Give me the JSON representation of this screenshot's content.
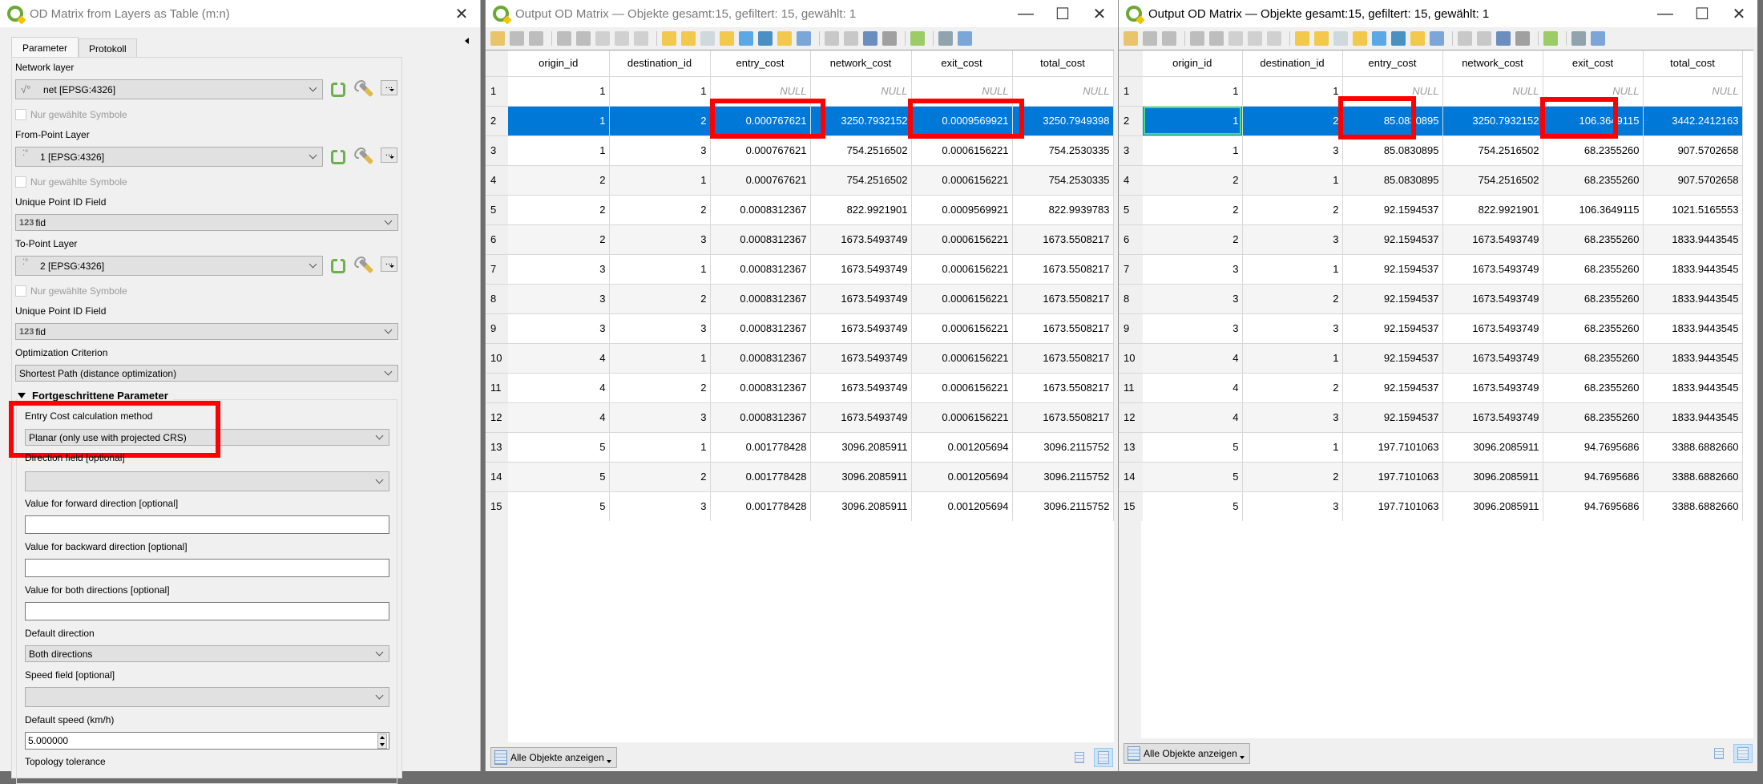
{
  "dialog": {
    "title": "OD Matrix from Layers as Table (m:n)",
    "tabs": [
      "Parameter",
      "Protokoll"
    ],
    "network_layer": {
      "label": "Network layer",
      "value": "net [EPSG:4326]"
    },
    "selected_only_label": "Nur gewählte Symbole",
    "from_point_layer": {
      "label": "From-Point Layer",
      "value": "1 [EPSG:4326]"
    },
    "from_id_field": {
      "label": "Unique Point ID Field",
      "type_badge": "123",
      "value": "fid"
    },
    "to_point_layer": {
      "label": "To-Point Layer",
      "value": "2 [EPSG:4326]"
    },
    "to_id_field": {
      "label": "Unique Point ID Field",
      "type_badge": "123",
      "value": "fid"
    },
    "optimization": {
      "label": "Optimization Criterion",
      "value": "Shortest Path (distance optimization)"
    },
    "advanced_group": "Fortgeschrittene Parameter",
    "entry_cost_method": {
      "label": "Entry Cost calculation method",
      "value": "Planar (only use with projected CRS)"
    },
    "direction_field": {
      "label": "Direction field [optional]",
      "value": ""
    },
    "forward_value": {
      "label": "Value for forward direction [optional]",
      "value": ""
    },
    "backward_value": {
      "label": "Value for backward direction [optional]",
      "value": ""
    },
    "both_value": {
      "label": "Value for both directions [optional]",
      "value": ""
    },
    "default_direction": {
      "label": "Default direction",
      "value": "Both directions"
    },
    "speed_field": {
      "label": "Speed field [optional]",
      "value": ""
    },
    "default_speed": {
      "label": "Default speed (km/h)",
      "value": "5.000000"
    },
    "topology_tolerance": {
      "label": "Topology tolerance"
    }
  },
  "tables": [
    {
      "title": "Output OD Matrix — Objekte gesamt:15, gefiltert: 15, gewählt: 1",
      "columns": [
        "origin_id",
        "destination_id",
        "entry_cost",
        "network_cost",
        "exit_cost",
        "total_cost"
      ],
      "selected_row": 2,
      "rows": [
        [
          "1",
          "1",
          "1",
          "NULL",
          "NULL",
          "NULL",
          "NULL"
        ],
        [
          "2",
          "1",
          "2",
          "0.000767621",
          "3250.7932152",
          "0.0009569921",
          "3250.7949398"
        ],
        [
          "3",
          "1",
          "3",
          "0.000767621",
          "754.2516502",
          "0.0006156221",
          "754.2530335"
        ],
        [
          "4",
          "2",
          "1",
          "0.000767621",
          "754.2516502",
          "0.0006156221",
          "754.2530335"
        ],
        [
          "5",
          "2",
          "2",
          "0.0008312367",
          "822.9921901",
          "0.0009569921",
          "822.9939783"
        ],
        [
          "6",
          "2",
          "3",
          "0.0008312367",
          "1673.5493749",
          "0.0006156221",
          "1673.5508217"
        ],
        [
          "7",
          "3",
          "1",
          "0.0008312367",
          "1673.5493749",
          "0.0006156221",
          "1673.5508217"
        ],
        [
          "8",
          "3",
          "2",
          "0.0008312367",
          "1673.5493749",
          "0.0006156221",
          "1673.5508217"
        ],
        [
          "9",
          "3",
          "3",
          "0.0008312367",
          "1673.5493749",
          "0.0006156221",
          "1673.5508217"
        ],
        [
          "10",
          "4",
          "1",
          "0.0008312367",
          "1673.5493749",
          "0.0006156221",
          "1673.5508217"
        ],
        [
          "11",
          "4",
          "2",
          "0.0008312367",
          "1673.5493749",
          "0.0006156221",
          "1673.5508217"
        ],
        [
          "12",
          "4",
          "3",
          "0.0008312367",
          "1673.5493749",
          "0.0006156221",
          "1673.5508217"
        ],
        [
          "13",
          "5",
          "1",
          "0.001778428",
          "3096.2085911",
          "0.001205694",
          "3096.2115752"
        ],
        [
          "14",
          "5",
          "2",
          "0.001778428",
          "3096.2085911",
          "0.001205694",
          "3096.2115752"
        ],
        [
          "15",
          "5",
          "3",
          "0.001778428",
          "3096.2085911",
          "0.001205694",
          "3096.2115752"
        ]
      ],
      "show_all_label": "Alle Objekte anzeigen"
    },
    {
      "title": "Output OD Matrix — Objekte gesamt:15, gefiltert: 15, gewählt: 1",
      "columns": [
        "origin_id",
        "destination_id",
        "entry_cost",
        "network_cost",
        "exit_cost",
        "total_cost"
      ],
      "selected_row": 2,
      "rows": [
        [
          "1",
          "1",
          "1",
          "NULL",
          "NULL",
          "NULL",
          "NULL"
        ],
        [
          "2",
          "1",
          "2",
          "85.0830895",
          "3250.7932152",
          "106.3649115",
          "3442.2412163"
        ],
        [
          "3",
          "1",
          "3",
          "85.0830895",
          "754.2516502",
          "68.2355260",
          "907.5702658"
        ],
        [
          "4",
          "2",
          "1",
          "85.0830895",
          "754.2516502",
          "68.2355260",
          "907.5702658"
        ],
        [
          "5",
          "2",
          "2",
          "92.1594537",
          "822.9921901",
          "106.3649115",
          "1021.5165553"
        ],
        [
          "6",
          "2",
          "3",
          "92.1594537",
          "1673.5493749",
          "68.2355260",
          "1833.9443545"
        ],
        [
          "7",
          "3",
          "1",
          "92.1594537",
          "1673.5493749",
          "68.2355260",
          "1833.9443545"
        ],
        [
          "8",
          "3",
          "2",
          "92.1594537",
          "1673.5493749",
          "68.2355260",
          "1833.9443545"
        ],
        [
          "9",
          "3",
          "3",
          "92.1594537",
          "1673.5493749",
          "68.2355260",
          "1833.9443545"
        ],
        [
          "10",
          "4",
          "1",
          "92.1594537",
          "1673.5493749",
          "68.2355260",
          "1833.9443545"
        ],
        [
          "11",
          "4",
          "2",
          "92.1594537",
          "1673.5493749",
          "68.2355260",
          "1833.9443545"
        ],
        [
          "12",
          "4",
          "3",
          "92.1594537",
          "1673.5493749",
          "68.2355260",
          "1833.9443545"
        ],
        [
          "13",
          "5",
          "1",
          "197.7101063",
          "3096.2085911",
          "94.7695686",
          "3388.6882660"
        ],
        [
          "14",
          "5",
          "2",
          "197.7101063",
          "3096.2085911",
          "94.7695686",
          "3388.6882660"
        ],
        [
          "15",
          "5",
          "3",
          "197.7101063",
          "3096.2085911",
          "94.7695686",
          "3388.6882660"
        ]
      ],
      "show_all_label": "Alle Objekte anzeigen"
    }
  ],
  "colors": {
    "selection": "#0078d7",
    "highlight_box": "#ff0000",
    "qgis_green": "#6aa832"
  }
}
